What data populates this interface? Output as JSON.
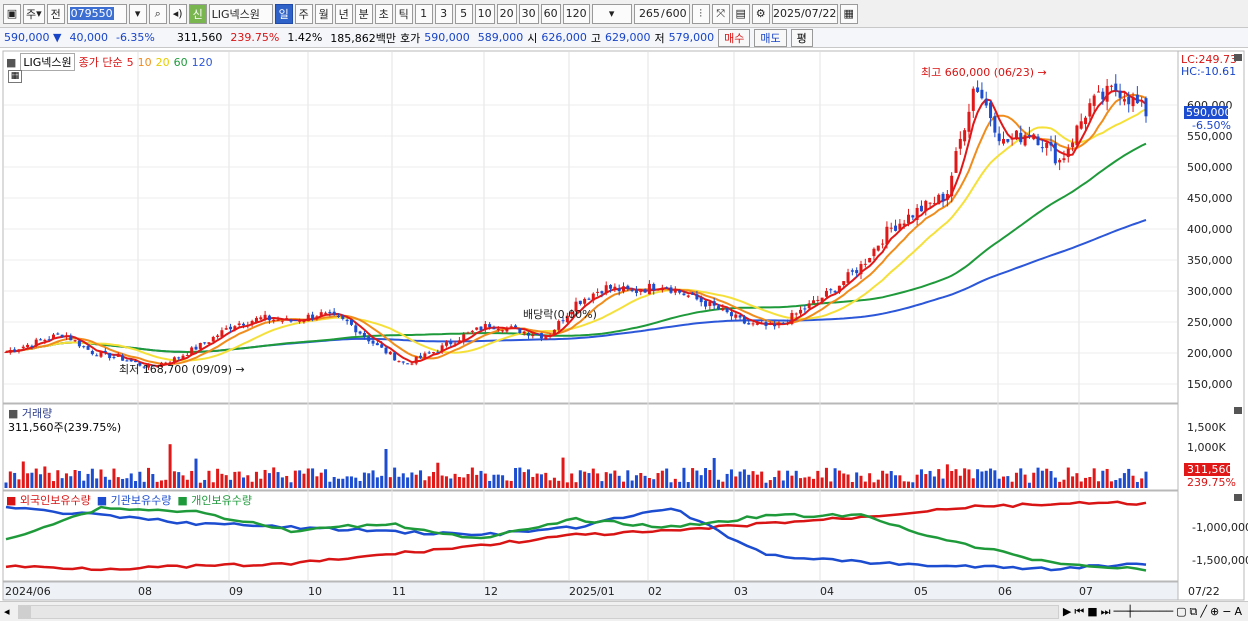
{
  "toolbar": {
    "period_label": "주",
    "prev_label": "전",
    "stock_code": "079550",
    "badge": "신",
    "stock_name": "LIG넥스원",
    "timeframes": [
      "일",
      "주",
      "월",
      "년",
      "분",
      "초",
      "틱"
    ],
    "ranges": [
      "1",
      "3",
      "5",
      "10",
      "20",
      "30",
      "60",
      "120"
    ],
    "count": "265",
    "count_total": "600",
    "date": "2025/07/22"
  },
  "quote": {
    "price": "590,000",
    "change": "40,000",
    "change_pct": "-6.35%",
    "volume": "311,560",
    "volume_ratio": "239.75%",
    "turnover": "1.42%",
    "amount": "185,862백만",
    "ask_label": "호가",
    "ask": "590,000",
    "bid": "589,000",
    "open_label": "시",
    "open": "626,000",
    "high_label": "고",
    "high": "629,000",
    "low_label": "저",
    "low": "579,000",
    "buy_label": "매수",
    "sell_label": "매도",
    "eval_label": "평"
  },
  "legend": {
    "name": "LIG넥스원",
    "prefix": "종가 단순",
    "ma": [
      "5",
      "10",
      "20",
      "60",
      "120"
    ]
  },
  "annotations": {
    "high_note": "최고 660,000 (06/23) →",
    "low_note": "최저 168,700 (09/09) →",
    "dividend": "배당락(0.00%)",
    "lc": "LC:249.73",
    "hc": "HC:-10.61",
    "price_tag": "590,000",
    "pct_tag": "-6.50%",
    "vol_tag": "311,560",
    "vol_pct_tag": "239.75%"
  },
  "volume_panel": {
    "title": "거래량",
    "summary": "311,560주(239.75%)",
    "ticks": [
      "1,500K",
      "1,000K"
    ]
  },
  "holdings_panel": {
    "legends": [
      "외국인보유수량",
      "기관보유수량",
      "개인보유수량"
    ],
    "ticks": [
      "-1,000,000",
      "-1,500,000"
    ]
  },
  "chart_data": {
    "type": "candlestick",
    "price_axis_ticks": [
      "600,000",
      "550,000",
      "500,000",
      "450,000",
      "400,000",
      "350,000",
      "300,000",
      "250,000",
      "200,000",
      "150,000"
    ],
    "date_labels": [
      "2024/06",
      "08",
      "09",
      "10",
      "11",
      "12",
      "2025/01",
      "02",
      "03",
      "04",
      "05",
      "06",
      "07",
      "07/22"
    ],
    "ylim": [
      125000,
      675000
    ],
    "close_series": [
      200000,
      215000,
      230000,
      200000,
      190000,
      175000,
      190000,
      215000,
      245000,
      255000,
      250000,
      262000,
      248000,
      210000,
      180000,
      200000,
      225000,
      245000,
      235000,
      225000,
      280000,
      305000,
      298000,
      310000,
      290000,
      270000,
      245000,
      240000,
      270000,
      300000,
      340000,
      400000,
      430000,
      455000,
      640000,
      540000,
      560000,
      510000,
      600000,
      630000,
      590000
    ],
    "ma_colors": {
      "5": "#e01818",
      "10": "#f08c1c",
      "20": "#f5e03a",
      "60": "#1f9a3b",
      "120": "#2c57d8"
    },
    "colors": {
      "up": "#e01818",
      "down": "#1c4ccf"
    }
  }
}
